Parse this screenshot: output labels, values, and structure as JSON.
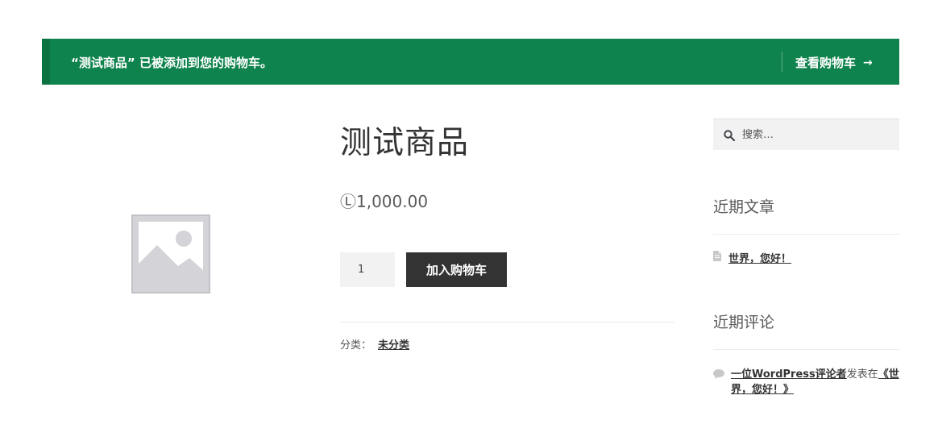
{
  "notice": {
    "message": "“测试商品” 已被添加到您的购物车。",
    "view_cart_label": "查看购物车",
    "arrow": "→"
  },
  "product": {
    "title": "测试商品",
    "price": "Ⓛ1,000.00",
    "quantity": "1",
    "add_to_cart_label": "加入购物车",
    "category_label": "分类：",
    "category_value": "未分类"
  },
  "sidebar": {
    "search_placeholder": "搜索…",
    "recent_posts_title": "近期文章",
    "recent_posts": [
      {
        "label": "世界，您好！"
      }
    ],
    "recent_comments_title": "近期评论",
    "recent_comments": [
      {
        "author": "一位WordPress评论者",
        "connector": "发表在",
        "post": "《世界，您好！》"
      }
    ]
  },
  "colors": {
    "notice_bg": "#0f834d",
    "button_bg": "#333333"
  }
}
